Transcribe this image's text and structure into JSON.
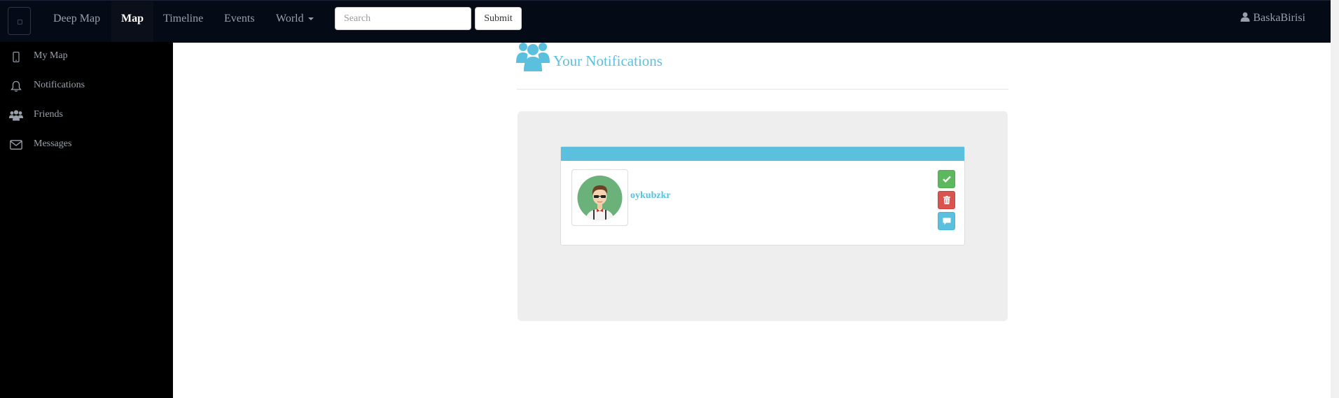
{
  "navbar": {
    "items": [
      {
        "label": "Deep Map"
      },
      {
        "label": "Map",
        "active": true
      },
      {
        "label": "Timeline"
      },
      {
        "label": "Events"
      },
      {
        "label": "World",
        "dropdown": true
      }
    ],
    "search": {
      "placeholder": "Search",
      "value": ""
    },
    "submit_label": "Submit",
    "user": {
      "name": "BaskaBirisi",
      "icon": "user-icon"
    }
  },
  "sidebar": {
    "items": [
      {
        "label": "My Map",
        "icon": "mobile-icon"
      },
      {
        "label": "Notifications",
        "icon": "bell-icon"
      },
      {
        "label": "Friends",
        "icon": "users-icon"
      },
      {
        "label": "Messages",
        "icon": "envelope-icon"
      }
    ]
  },
  "main": {
    "title": "Your Notifications",
    "title_icon": "users-icon",
    "notifications": [
      {
        "username": "oykubzkr",
        "avatar": "avatar-man-sunglasses",
        "actions": [
          "accept",
          "delete",
          "message"
        ]
      }
    ]
  },
  "colors": {
    "navbar_bg": "#050a17",
    "sidebar_bg": "#000000",
    "accent": "#5bc0de",
    "success": "#5cb85c",
    "danger": "#d9534f",
    "well_bg": "#eeeeee"
  }
}
